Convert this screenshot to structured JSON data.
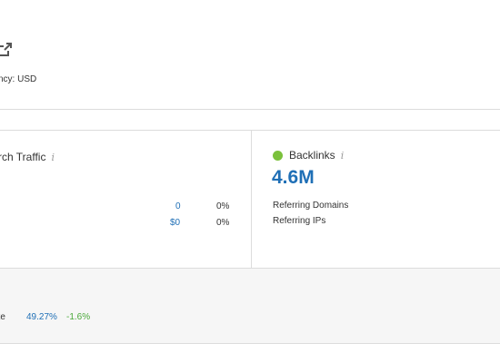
{
  "header": {
    "currency_text": "ncy: USD"
  },
  "traffic": {
    "title": "rch Traffic",
    "info": "i",
    "rows": [
      {
        "value": "0",
        "change": "0%"
      },
      {
        "value": "$0",
        "change": "0%"
      }
    ]
  },
  "backlinks": {
    "title": "Backlinks",
    "info": "i",
    "value": "4.6M",
    "labels": [
      "Referring Domains",
      "Referring IPs"
    ],
    "dot_color": "#7bc13c"
  },
  "bounce": {
    "label": "ate",
    "value": "49.27%",
    "change": "-1.6%"
  },
  "colors": {
    "accent_blue": "#1f6fb6",
    "positive_green": "#4aa93a",
    "divider": "#dcdcdc"
  }
}
